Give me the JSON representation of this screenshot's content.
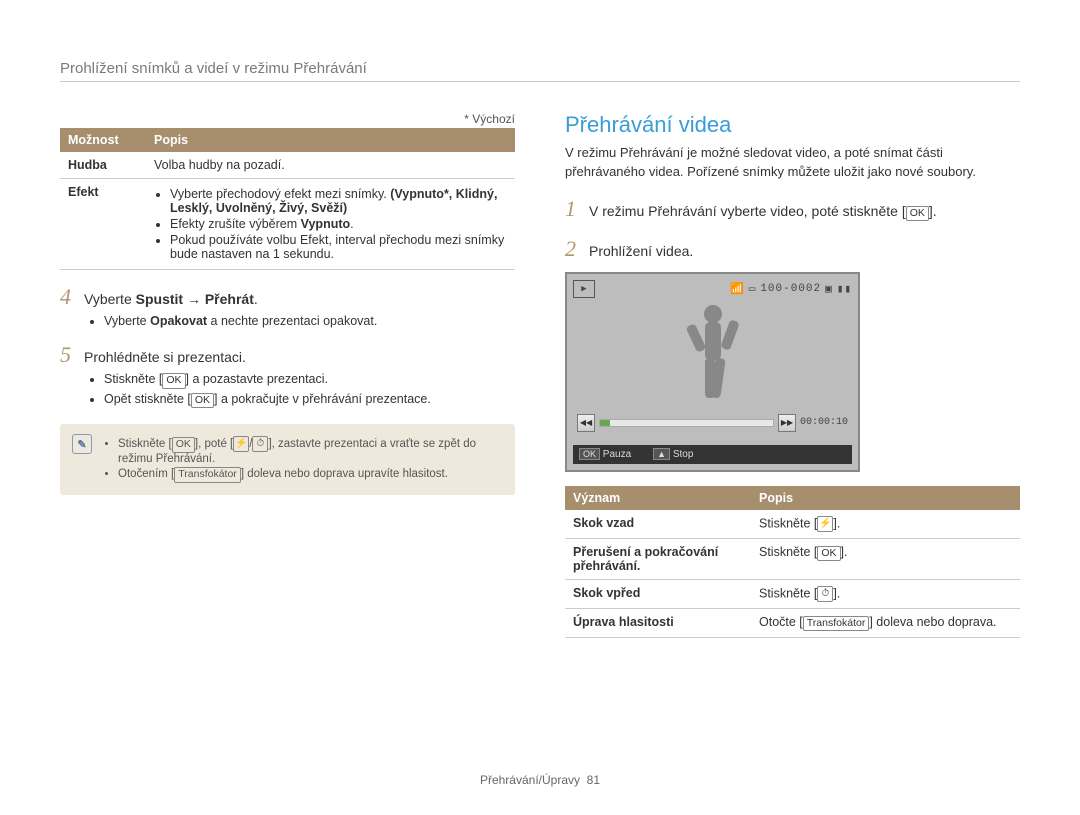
{
  "header": {
    "title": "Prohlížení snímků a videí v režimu Přehrávání"
  },
  "left": {
    "default_note": "* Výchozí",
    "table": {
      "headers": [
        "Možnost",
        "Popis"
      ],
      "rows": [
        {
          "opt": "Hudba",
          "desc_plain": "Volba hudby na pozadí."
        },
        {
          "opt": "Efekt",
          "bullets": {
            "b1": "Vyberte přechodový efekt mezi snímky.",
            "b1_bold": "(Vypnuto*, Klidný, Lesklý, Uvolněný, Živý, Svěží)",
            "b2a": "Efekty zrušíte výběrem ",
            "b2b": "Vypnuto",
            "b2c": ".",
            "b3": "Pokud používáte volbu Efekt, interval přechodu mezi snímky bude nastaven na 1 sekundu."
          }
        }
      ]
    },
    "step4": {
      "num": "4",
      "prefix": "Vyberte ",
      "bold": "Spustit → Přehrát",
      "suffix": "."
    },
    "step4_sub": {
      "a": "Vyberte ",
      "b": "Opakovat",
      "c": " a nechte prezentaci opakovat."
    },
    "step5": {
      "num": "5",
      "text": "Prohlédněte si prezentaci."
    },
    "step5_subs": {
      "s1a": "Stiskněte [",
      "s1ok": "OK",
      "s1b": "] a pozastavte prezentaci.",
      "s2a": "Opět stiskněte [",
      "s2ok": "OK",
      "s2b": "] a pokračujte v přehrávání prezentace."
    },
    "note": {
      "l1a": "Stiskněte [",
      "l1ok": "OK",
      "l1b": "], poté [",
      "l1sym1": "⚡",
      "l1slash": "/",
      "l1sym2": "⏱",
      "l1c": "], zastavte prezentaci a vraťte se zpět do režimu Přehrávání.",
      "l2a": "Otočením [",
      "l2b": "Transfokátor",
      "l2c": "] doleva nebo doprava upravíte hlasitost."
    }
  },
  "right": {
    "heading": "Přehrávání videa",
    "intro": "V režimu Přehrávání je možné sledovat video, a poté snímat části přehrávaného videa. Pořízené snímky můžete uložit jako nové soubory.",
    "step1": {
      "num": "1",
      "a": "V režimu Přehrávání vyberte video, poté stiskněte [",
      "ok": "OK",
      "b": "]."
    },
    "step2": {
      "num": "2",
      "text": "Prohlížení videa."
    },
    "screenshot": {
      "counter": "100-0002",
      "timecode": "00:00:10",
      "pause_label": "Pauza",
      "stop_label": "Stop",
      "ok": "OK"
    },
    "table": {
      "headers": [
        "Význam",
        "Popis"
      ],
      "rows": {
        "r1": {
          "k": "Skok vzad",
          "v_a": "Stiskněte [",
          "v_sym": "⚡",
          "v_b": "]."
        },
        "r2": {
          "k": "Přerušení a pokračování přehrávání.",
          "v_a": "Stiskněte [",
          "v_sym": "OK",
          "v_b": "]."
        },
        "r3": {
          "k": "Skok vpřed",
          "v_a": "Stiskněte [",
          "v_sym": "⏱",
          "v_b": "]."
        },
        "r4": {
          "k": "Úprava hlasitosti",
          "v_a": "Otočte [",
          "v_bold": "Transfokátor",
          "v_b": "] doleva nebo doprava."
        }
      }
    }
  },
  "footer": {
    "section": "Přehrávání/Úpravy",
    "page": "81"
  }
}
